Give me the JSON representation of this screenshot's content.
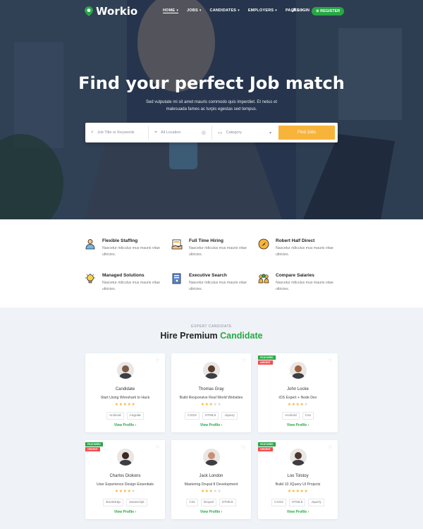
{
  "brand": {
    "name": "Workio"
  },
  "nav": {
    "items": [
      {
        "label": "HOME"
      },
      {
        "label": "JOBS"
      },
      {
        "label": "CANDIDATES"
      },
      {
        "label": "EMPLOYERS"
      },
      {
        "label": "PAGES"
      }
    ],
    "login_label": "LOGIN",
    "register_label": "REGISTER"
  },
  "hero": {
    "title": "Find your perfect Job match",
    "subtitle": "Sed vulputate mi sit amet mauris commodo quis imperdiet. Et netus et malesuada fames ac turpis egestas sed tempus."
  },
  "search": {
    "keyword_placeholder": "Job Title or Keywords",
    "location_placeholder": "All Location",
    "category_placeholder": "Category",
    "button_label": "Find Jobs"
  },
  "features": [
    {
      "title": "Flexible Staffing",
      "desc": "Nascetur ridiculus mus mauris vitae ultricies.",
      "icon": "person-icon"
    },
    {
      "title": "Full Time Hiring",
      "desc": "Nascetur ridiculus mus mauris vitae ultricies.",
      "icon": "handshake-icon"
    },
    {
      "title": "Robert Half Direct",
      "desc": "Nascetur ridiculus mus mauris vitae ultricies.",
      "icon": "compass-icon"
    },
    {
      "title": "Managed Solutions",
      "desc": "Nascetur ridiculus mus mauris vitae ultricies.",
      "icon": "lightbulb-icon"
    },
    {
      "title": "Executive Search",
      "desc": "Nascetur ridiculus mus mauris vitae ultricies.",
      "icon": "document-search-icon"
    },
    {
      "title": "Compare Salaries",
      "desc": "Nascetur ridiculus mus mauris vitae ultricies.",
      "icon": "group-icon"
    }
  ],
  "candidates_section": {
    "eyebrow": "EXPERT CANDIDATE",
    "title_prefix": "Hire Premium",
    "title_highlight": "Candidate"
  },
  "candidates": [
    {
      "name": "Candidate",
      "role": "Start Using Wireshark to Hack",
      "rating": 5,
      "tags": [
        "Android",
        "Angular"
      ],
      "cta": "View Profile",
      "badges": [],
      "avatar_color": "#7a5a48"
    },
    {
      "name": "Thomas Gray",
      "role": "Build Responsive Real World Websites",
      "rating": 3,
      "tags": [
        "CSS3",
        "HTML5",
        "Jquery"
      ],
      "cta": "View Profile",
      "badges": [],
      "avatar_color": "#5a3b2c"
    },
    {
      "name": "John Locke",
      "role": "iOS Expert + Node Dev",
      "rating": 4,
      "tags": [
        "Android",
        "Css"
      ],
      "cta": "View Profile",
      "badges": [
        "FEATURED",
        "URGENT"
      ],
      "avatar_color": "#a0603e"
    },
    {
      "name": "Charlos Diokons",
      "role": "User Experience Design Essentials",
      "rating": 4,
      "tags": [
        "Bootstrap",
        "Javascript"
      ],
      "cta": "View Profile",
      "badges": [
        "FEATURED",
        "URGENT"
      ],
      "avatar_color": "#3a2a22"
    },
    {
      "name": "Jack London",
      "role": "Mastering Drupal 8 Development",
      "rating": 3,
      "tags": [
        "Css",
        "Drupal",
        "HTML5"
      ],
      "cta": "View Profile",
      "badges": [],
      "avatar_color": "#c98f72"
    },
    {
      "name": "Loo Tolstoy",
      "role": "Build 10 JQuery UI Projects",
      "rating": 5,
      "tags": [
        "CSS3",
        "HTML5",
        "Jquery"
      ],
      "cta": "View Profile",
      "badges": [
        "FEATURED",
        "URGENT"
      ],
      "avatar_color": "#4b372d"
    }
  ],
  "colors": {
    "accent_green": "#28a745",
    "accent_orange": "#f8b43a",
    "urgent_red": "#f24e4e"
  }
}
